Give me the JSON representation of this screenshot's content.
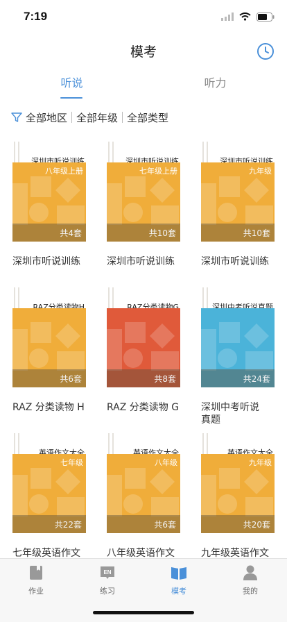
{
  "status": {
    "time": "7:19"
  },
  "header": {
    "title": "模考",
    "history_icon": "clock-icon"
  },
  "tabs": [
    {
      "label": "听说",
      "active": true
    },
    {
      "label": "听力",
      "active": false
    }
  ],
  "filters": {
    "icon": "filter-icon",
    "region": "全部地区",
    "grade": "全部年级",
    "type": "全部类型"
  },
  "accent_color": "#4a90d9",
  "cards": [
    {
      "title": "深圳市听说训练",
      "subtitle": "八年级上册",
      "count": "共4套",
      "caption": "深圳市听说训练",
      "color": "#f0ad3a"
    },
    {
      "title": "深圳市听说训练",
      "subtitle": "七年级上册",
      "count": "共10套",
      "caption": "深圳市听说训练",
      "color": "#f0ad3a"
    },
    {
      "title": "深圳市听说训练",
      "subtitle": "九年级",
      "count": "共10套",
      "caption": "深圳市听说训练",
      "color": "#f0ad3a"
    },
    {
      "title": "RAZ分类读物H",
      "subtitle": "",
      "count": "共6套",
      "caption": "RAZ 分类读物 H",
      "color": "#f0ad3a"
    },
    {
      "title": "RAZ分类读物G",
      "subtitle": "",
      "count": "共8套",
      "caption": "RAZ 分类读物 G",
      "color": "#e05a3a"
    },
    {
      "title": "深圳中考听说真题",
      "subtitle": "",
      "count": "共24套",
      "caption": "深圳中考听说真题",
      "color": "#4bb3d9"
    },
    {
      "title": "英语作文大全",
      "subtitle": "七年级",
      "count": "共22套",
      "caption": "七年级英语作文大全",
      "color": "#f0ad3a"
    },
    {
      "title": "英语作文大全",
      "subtitle": "八年级",
      "count": "共6套",
      "caption": "八年级英语作文大全",
      "color": "#f0ad3a"
    },
    {
      "title": "英语作文大全",
      "subtitle": "九年级",
      "count": "共20套",
      "caption": "九年级英语作文大全",
      "color": "#f0ad3a"
    }
  ],
  "bottom_tabs": [
    {
      "label": "作业",
      "icon": "homework-icon",
      "active": false
    },
    {
      "label": "练习",
      "icon": "practice-en-icon",
      "active": false
    },
    {
      "label": "模考",
      "icon": "book-icon",
      "active": true
    },
    {
      "label": "我的",
      "icon": "profile-icon",
      "active": false
    }
  ]
}
